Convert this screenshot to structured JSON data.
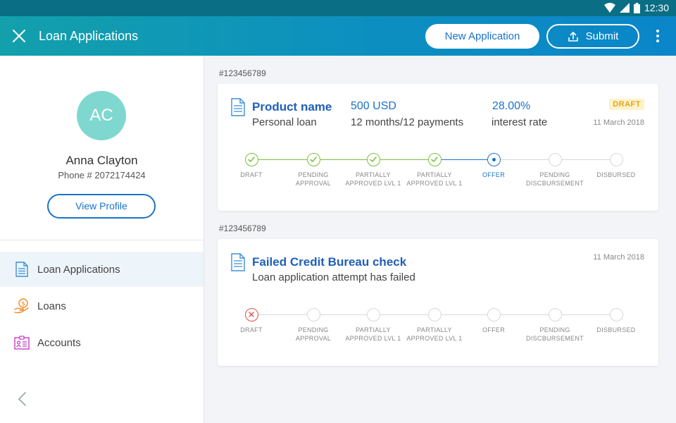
{
  "status_bar": {
    "time": "12:30"
  },
  "app_bar": {
    "title": "Loan Applications",
    "new_application_label": "New Application",
    "submit_label": "Submit"
  },
  "profile": {
    "initials": "AC",
    "name": "Anna Clayton",
    "phone": "Phone # 2072174424",
    "view_profile_label": "View Profile"
  },
  "sidebar": {
    "items": [
      {
        "label": "Loan Applications",
        "icon": "document-icon",
        "active": true
      },
      {
        "label": "Loans",
        "icon": "money-hand-icon",
        "active": false
      },
      {
        "label": "Accounts",
        "icon": "id-card-icon",
        "active": false
      }
    ]
  },
  "steps": [
    {
      "line1": "Draft",
      "line2": ""
    },
    {
      "line1": "Pending",
      "line2": "Approval"
    },
    {
      "line1": "Partially",
      "line2": "Approved lvl 1"
    },
    {
      "line1": "Partially",
      "line2": "Approved lvl 1"
    },
    {
      "line1": "Offer",
      "line2": ""
    },
    {
      "line1": "Pending",
      "line2": "Discbursement"
    },
    {
      "line1": "Disbursed",
      "line2": ""
    }
  ],
  "applications": [
    {
      "id": "#123456789",
      "title": "Product name",
      "subtitle": "Personal loan",
      "amount": "500 USD",
      "term": "12 months/12 payments",
      "rate": "28.00%",
      "rate_label": "interest rate",
      "badge": "DRAFT",
      "date": "11 March 2018",
      "step_states": [
        "done",
        "done",
        "done",
        "done",
        "current",
        "pending",
        "pending"
      ]
    },
    {
      "id": "#123456789",
      "title": "Failed Credit Bureau check",
      "subtitle": "Loan application attempt has failed",
      "date": "11 March 2018",
      "step_states": [
        "failed",
        "pending",
        "pending",
        "pending",
        "pending",
        "pending",
        "pending"
      ]
    }
  ],
  "colors": {
    "done": "#7cbf3a",
    "current": "#1a73c8",
    "failed": "#e24b4b",
    "pending": "#d4d8dd",
    "accent": "#1a73c8"
  }
}
